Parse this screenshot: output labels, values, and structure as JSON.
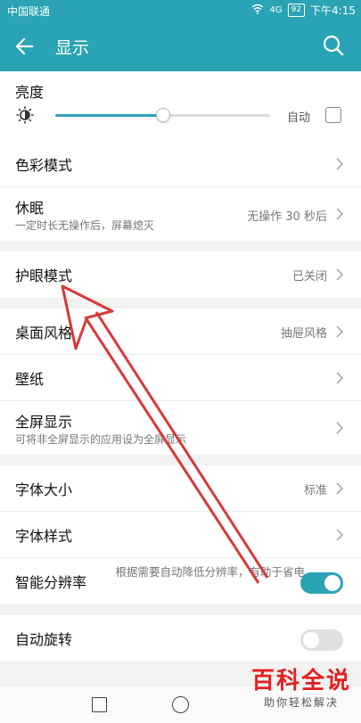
{
  "status": {
    "carrier": "中国联通",
    "signal": "4G",
    "battery": "92",
    "time": "下午4:15"
  },
  "header": {
    "title": "显示"
  },
  "brightness": {
    "label": "亮度",
    "auto_label": "自动",
    "level": 0.5,
    "auto_checked": false
  },
  "sections": [
    [
      {
        "id": "color",
        "label": "色彩模式",
        "value": ""
      },
      {
        "id": "sleep",
        "label": "休眠",
        "sub": "一定时长无操作后，屏幕熄灭",
        "value": "无操作 30 秒后"
      }
    ],
    [
      {
        "id": "eye",
        "label": "护眼模式",
        "value": "已关闭"
      }
    ],
    [
      {
        "id": "style",
        "label": "桌面风格",
        "value": "抽屉风格"
      },
      {
        "id": "wallpaper",
        "label": "壁纸",
        "value": ""
      },
      {
        "id": "fullscreen",
        "label": "全屏显示",
        "sub": "可将非全屏显示的应用设为全屏显示",
        "value": ""
      }
    ],
    [
      {
        "id": "fontsize",
        "label": "字体大小",
        "value": "标准"
      },
      {
        "id": "fontstyle",
        "label": "字体样式",
        "value": ""
      }
    ]
  ],
  "smart_resolution": {
    "label": "智能分辨率",
    "desc": "根据需要自动降低分辨率，有助于省电",
    "on": true
  },
  "auto_rotate": {
    "label": "自动旋转",
    "on": false
  },
  "watermark": {
    "title": "百科全说",
    "subtitle": "助你轻松解决"
  },
  "colors": {
    "accent": "#2aa3b4",
    "arrow": "#d63a3a",
    "watermark": "#e02020"
  }
}
